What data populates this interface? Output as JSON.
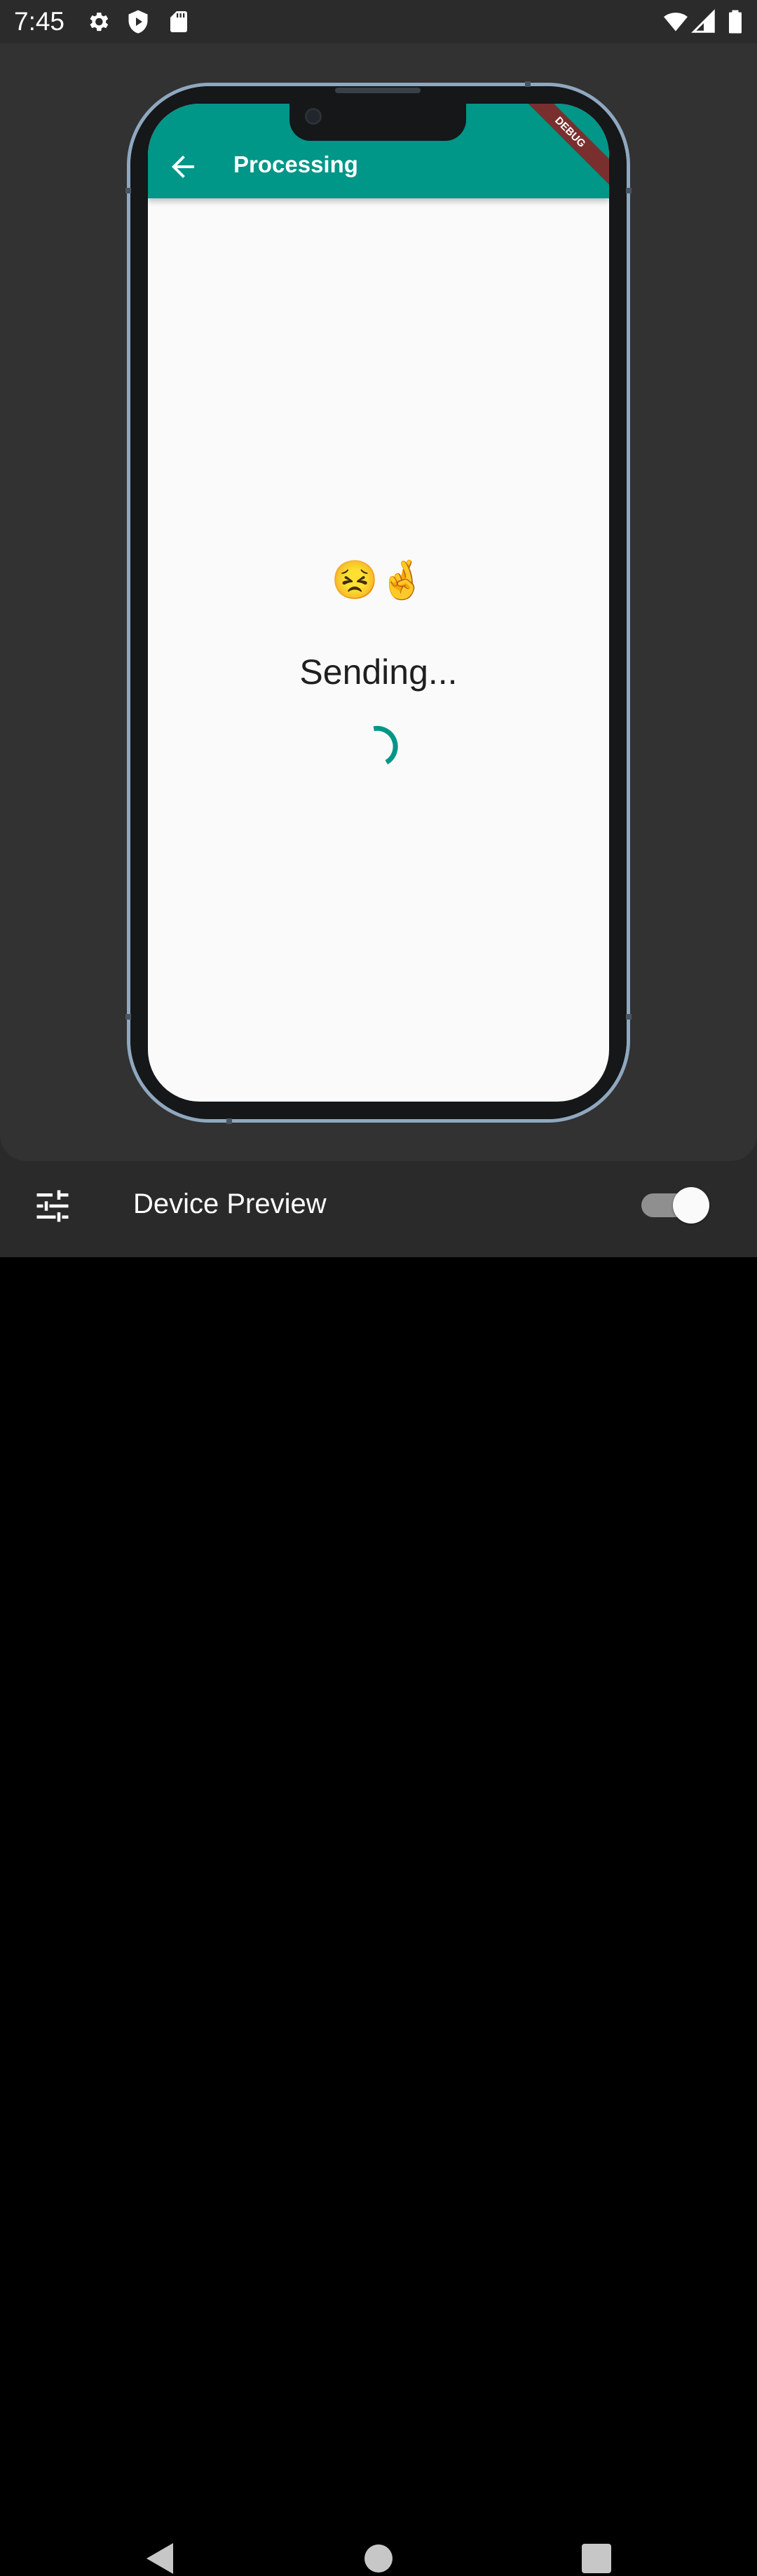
{
  "status_bar": {
    "time": "7:45",
    "left_icons": [
      "gear-icon",
      "shield-play-icon",
      "sd-card-icon"
    ],
    "right_icons": [
      "wifi-icon",
      "signal-icon",
      "battery-icon"
    ]
  },
  "app": {
    "title": "Processing",
    "back_icon": "arrow-back-icon",
    "debug_label": "DEBUG",
    "accent_color": "#009688",
    "emojis": "😣🤞",
    "status_text": "Sending..."
  },
  "device_preview": {
    "label": "Device Preview",
    "settings_icon": "tune-icon",
    "toggle_on": true
  },
  "nav_bar": {
    "buttons": [
      "back-triangle-icon",
      "home-circle-icon",
      "recents-square-icon"
    ]
  }
}
